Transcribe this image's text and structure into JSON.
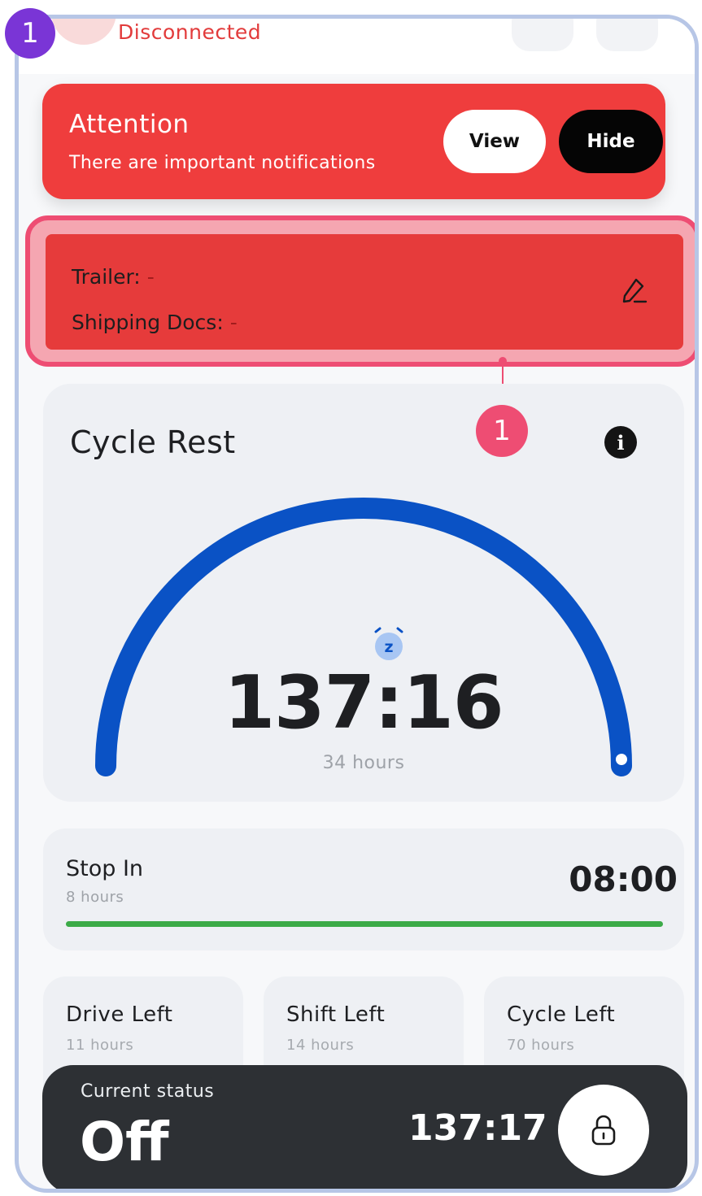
{
  "header": {
    "connection_status": "Disconnected"
  },
  "annotations": {
    "corner_step": "1",
    "callout_step": "1"
  },
  "attention": {
    "title": "Attention",
    "message": "There are important notifications",
    "view_label": "View",
    "hide_label": "Hide"
  },
  "trailer_card": {
    "trailer_label": "Trailer:",
    "trailer_value": "-",
    "docs_label": "Shipping Docs:",
    "docs_value": "-",
    "edit_icon": "pencil-edit-icon"
  },
  "cycle_rest": {
    "title": "Cycle Rest",
    "info_icon": "info-icon",
    "sleep_icon": "alarm-snooze-icon",
    "time": "137:16",
    "caption": "34 hours",
    "progress_fraction": 1.0
  },
  "stop_in": {
    "label": "Stop In",
    "sub": "8 hours",
    "value": "08:00",
    "progress_fraction": 1.0
  },
  "limits": [
    {
      "label": "Drive Left",
      "sub": "11 hours"
    },
    {
      "label": "Shift Left",
      "sub": "14 hours"
    },
    {
      "label": "Cycle Left",
      "sub": "70 hours"
    }
  ],
  "status": {
    "caption": "Current status",
    "value": "Off",
    "timer": "137:17",
    "lock_icon": "lock-icon"
  },
  "colors": {
    "alert_red": "#ef3d3d",
    "gauge_blue": "#0a52c5",
    "progress_green": "#3cab48",
    "annotation_pink": "#ee4d73",
    "annotation_purple": "#7a35d6"
  }
}
